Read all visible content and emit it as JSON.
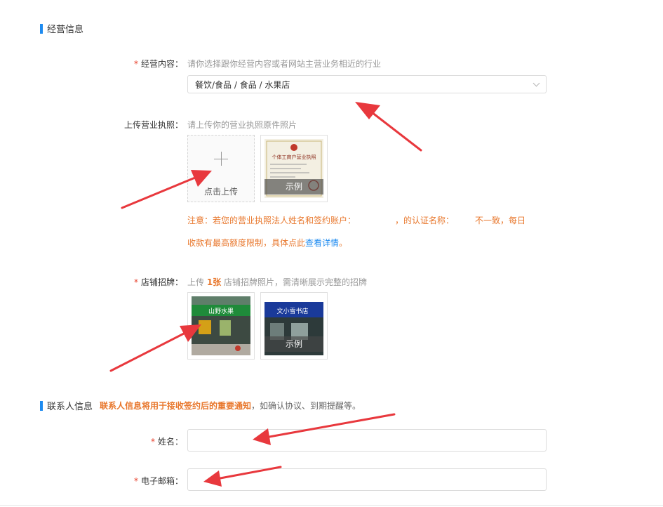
{
  "business_section": {
    "title": "经营信息"
  },
  "business_content": {
    "label": "经营内容：",
    "hint": "请你选择跟你经营内容或者网站主营业务相近的行业",
    "selected_value": "餐饮/食品 / 食品 / 水果店"
  },
  "license_upload": {
    "label": "上传营业执照：",
    "hint": "请上传你的营业执照原件照片",
    "upload_label": "点击上传",
    "example_label": "示例",
    "sample_image_text": "个体工商户营业执照",
    "note_line1": "注意：若您的营业执照法人姓名和签约账户：",
    "note_line1_mid": "，的认证名称：",
    "note_line1_end": "不一致，每日",
    "note_line2": "收款有最高额度限制，具体点此",
    "note_link": "查看详情",
    "note_end": "。"
  },
  "storefront": {
    "label": "店铺招牌：",
    "hint_before": "上传",
    "hint_count": "1张",
    "hint_after": "店铺招牌照片，需清晰展示完整的招牌",
    "example_label": "示例",
    "shop_sign_text": "山野水果",
    "example_sign_text": "文小雪书店"
  },
  "contact_section": {
    "title": "联系人信息",
    "note_bold": "联系人信息将用于接收签约后的重要通知",
    "note_rest": "，如确认协议、到期提醒等。"
  },
  "name_field": {
    "label": "姓名：",
    "value": ""
  },
  "email_field": {
    "label": "电子邮箱：",
    "value": ""
  },
  "colors": {
    "accent": "#1e8bf0",
    "required": "#e8412c",
    "warning": "#e8772c",
    "annotation_arrow": "#e8383d"
  }
}
